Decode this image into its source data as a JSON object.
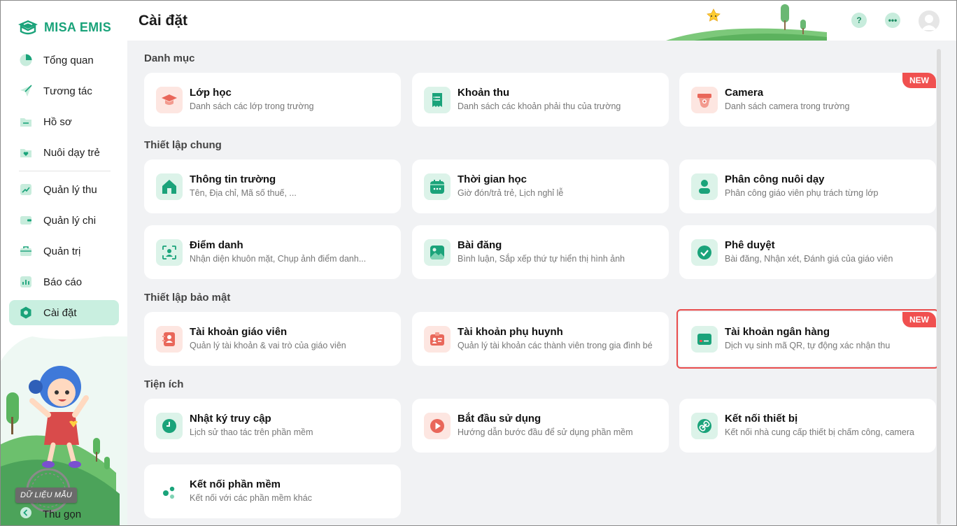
{
  "app": {
    "logo_text": "MISA EMIS"
  },
  "sidebar": {
    "items": [
      {
        "label": "Tổng quan",
        "icon": "pie-chart-icon"
      },
      {
        "label": "Tương tác",
        "icon": "send-icon"
      },
      {
        "label": "Hồ sơ",
        "icon": "folder-icon"
      },
      {
        "label": "Nuôi dạy trẻ",
        "icon": "heart-folder-icon"
      },
      {
        "label": "Quản lý thu",
        "icon": "trend-up-icon"
      },
      {
        "label": "Quản lý chi",
        "icon": "wallet-icon"
      },
      {
        "label": "Quản trị",
        "icon": "briefcase-icon"
      },
      {
        "label": "Báo cáo",
        "icon": "bar-chart-icon"
      },
      {
        "label": "Cài đặt",
        "icon": "settings-hex-icon",
        "active": true
      }
    ],
    "sample_badge": "DỮ LIỆU MẪU",
    "collapse_label": "Thu gọn"
  },
  "header": {
    "title": "Cài đặt"
  },
  "sections": [
    {
      "title": "Danh mục"
    },
    {
      "title": "Thiết lập chung"
    },
    {
      "title": "Thiết lập bảo mật"
    },
    {
      "title": "Tiện ích"
    }
  ],
  "new_badge": "NEW",
  "cards": [
    {
      "title": "Lớp học",
      "desc": "Danh sách các lớp trong trường",
      "icon": "graduation-cap-icon"
    },
    {
      "title": "Khoản thu",
      "desc": "Danh sách các khoản phải thu của trường",
      "icon": "receipt-icon"
    },
    {
      "title": "Camera",
      "desc": "Danh sách camera trong trường",
      "icon": "camera-icon",
      "new": true
    },
    {
      "title": "Thông tin trường",
      "desc": "Tên, Địa chỉ, Mã số thuế, ...",
      "icon": "home-icon"
    },
    {
      "title": "Thời gian học",
      "desc": "Giờ đón/trả trẻ, Lịch nghỉ lễ",
      "icon": "calendar-icon"
    },
    {
      "title": "Phân công nuôi dạy",
      "desc": "Phân công giáo viên phụ trách từng lớp",
      "icon": "person-icon"
    },
    {
      "title": "Điểm danh",
      "desc": "Nhận diện khuôn mặt, Chụp ảnh điểm danh...",
      "icon": "face-scan-icon"
    },
    {
      "title": "Bài đăng",
      "desc": "Bình luận, Sắp xếp thứ tự hiển thị hình ảnh",
      "icon": "image-icon"
    },
    {
      "title": "Phê duyệt",
      "desc": "Bài đăng, Nhận xét, Đánh giá của giáo viên",
      "icon": "check-circle-icon"
    },
    {
      "title": "Tài khoản giáo viên",
      "desc": "Quản lý tài khoản & vai trò của giáo viên",
      "icon": "teacher-book-icon"
    },
    {
      "title": "Tài khoản phụ huynh",
      "desc": "Quản lý tài khoản các thành viên trong gia đình bé",
      "icon": "id-card-icon"
    },
    {
      "title": "Tài khoản ngân hàng",
      "desc": "Dịch vụ sinh mã QR, tự động xác nhận thu",
      "icon": "bank-card-icon",
      "new": true,
      "highlighted": true
    },
    {
      "title": "Nhật ký truy cập",
      "desc": "Lịch sử thao tác trên phần mềm",
      "icon": "clock-icon"
    },
    {
      "title": "Bắt đầu sử dụng",
      "desc": "Hướng dẫn bước đầu để sử dụng phần mềm",
      "icon": "play-icon"
    },
    {
      "title": "Kết nối thiết bị",
      "desc": "Kết nối nhà cung cấp thiết bị chấm công, camera",
      "icon": "link-icon"
    },
    {
      "title": "Kết nối phần mềm",
      "desc": "Kết nối với các phần mềm khác",
      "icon": "dots-connect-icon"
    }
  ],
  "colors": {
    "brand": "#1aa37a",
    "active_bg": "#c9efe0",
    "new_badge": "#f0504f",
    "highlight": "#e84c4c"
  }
}
